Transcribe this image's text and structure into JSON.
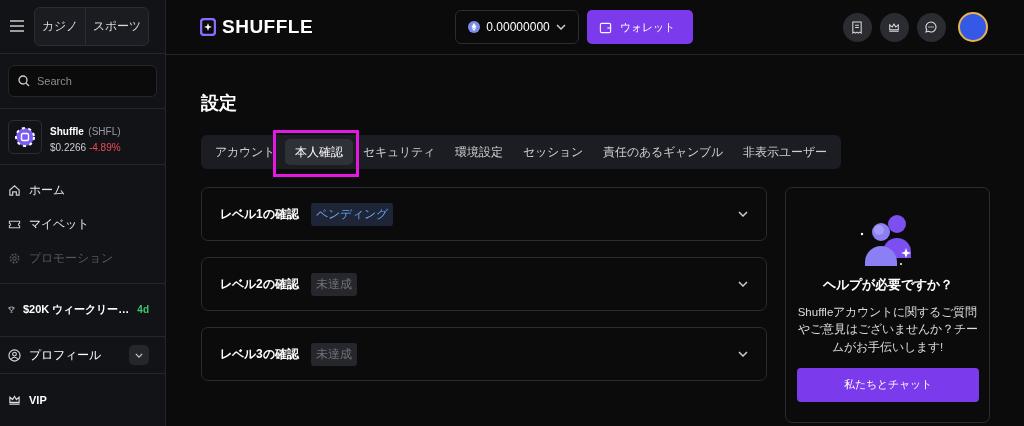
{
  "sidebar": {
    "modes": [
      {
        "label": "カジノ",
        "selected": false
      },
      {
        "label": "スポーツ",
        "selected": false
      }
    ],
    "search": {
      "placeholder": "Search"
    },
    "token": {
      "name": "Shuffle",
      "symbol": "(SHFL)",
      "price": "$0.2266",
      "change": "-4.89%"
    },
    "nav": [
      {
        "label": "ホーム",
        "kind": "home",
        "disabled": false
      },
      {
        "label": "マイベット",
        "kind": "ticket",
        "disabled": false
      },
      {
        "label": "プロモーション",
        "kind": "gear",
        "disabled": true
      }
    ],
    "race": {
      "label": "$20K ウィークリー…",
      "badge": "4d"
    },
    "profile": {
      "label": "プロフィール",
      "expanded": false
    },
    "vip": {
      "label": "VIP"
    }
  },
  "header": {
    "logo": "SHUFFLE",
    "balance": "0.00000000",
    "wallet": "ウォレット"
  },
  "page": {
    "title": "設定",
    "tabs": [
      {
        "label": "アカウント",
        "selected": false,
        "highlighted": false
      },
      {
        "label": "本人確認",
        "selected": true,
        "highlighted": true
      },
      {
        "label": "セキュリティ",
        "selected": false,
        "highlighted": false
      },
      {
        "label": "環境設定",
        "selected": false,
        "highlighted": false
      },
      {
        "label": "セッション",
        "selected": false,
        "highlighted": false
      },
      {
        "label": "責任のあるギャンブル",
        "selected": false,
        "highlighted": false
      },
      {
        "label": "非表示ユーザー",
        "selected": false,
        "highlighted": false
      }
    ],
    "levels": [
      {
        "title": "レベル1の確認",
        "status": "ペンディング",
        "kind": "pending"
      },
      {
        "title": "レベル2の確認",
        "status": "未達成",
        "kind": "incomplete"
      },
      {
        "title": "レベル3の確認",
        "status": "未達成",
        "kind": "incomplete"
      }
    ],
    "help": {
      "title": "ヘルプが必要ですか？",
      "text": "Shuffleアカウントに関するご質問やご意見はございませんか？チームがお手伝いします!",
      "button": "私たちとチャット"
    }
  }
}
